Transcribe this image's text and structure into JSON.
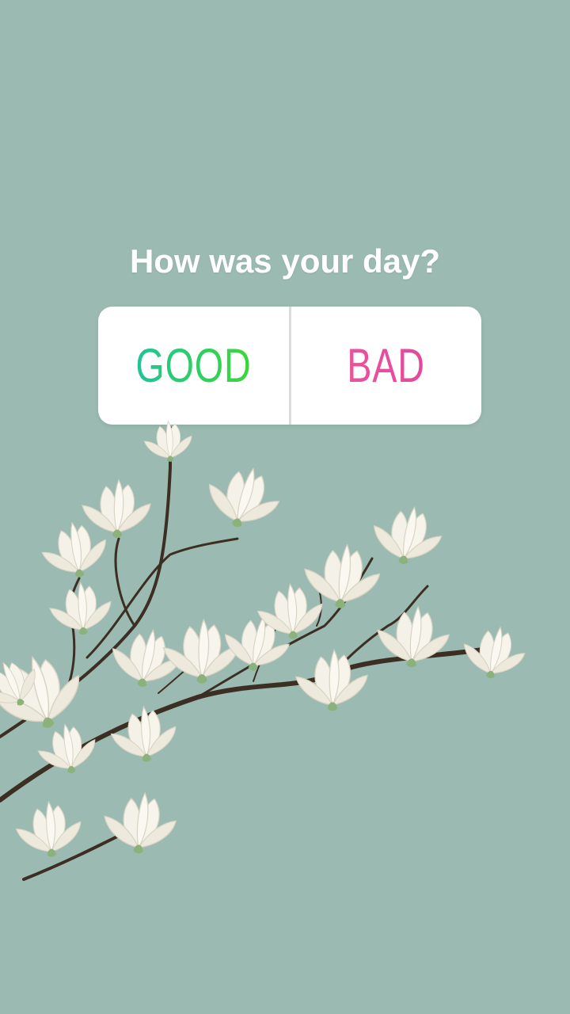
{
  "poll": {
    "question": "How was your day?",
    "option_good": "GOOD",
    "option_bad": "BAD"
  },
  "colors": {
    "background": "#9bbab1",
    "good_gradient_start": "#1fc0a5",
    "good_gradient_end": "#3ddb2a",
    "bad_gradient_start": "#f0559a",
    "bad_gradient_end": "#e0449f",
    "petal": "#f4f1e8",
    "branch": "#3d2e24",
    "sepal": "#8ab27a"
  },
  "illustration": {
    "icon": "magnolia-branch-illustration"
  }
}
